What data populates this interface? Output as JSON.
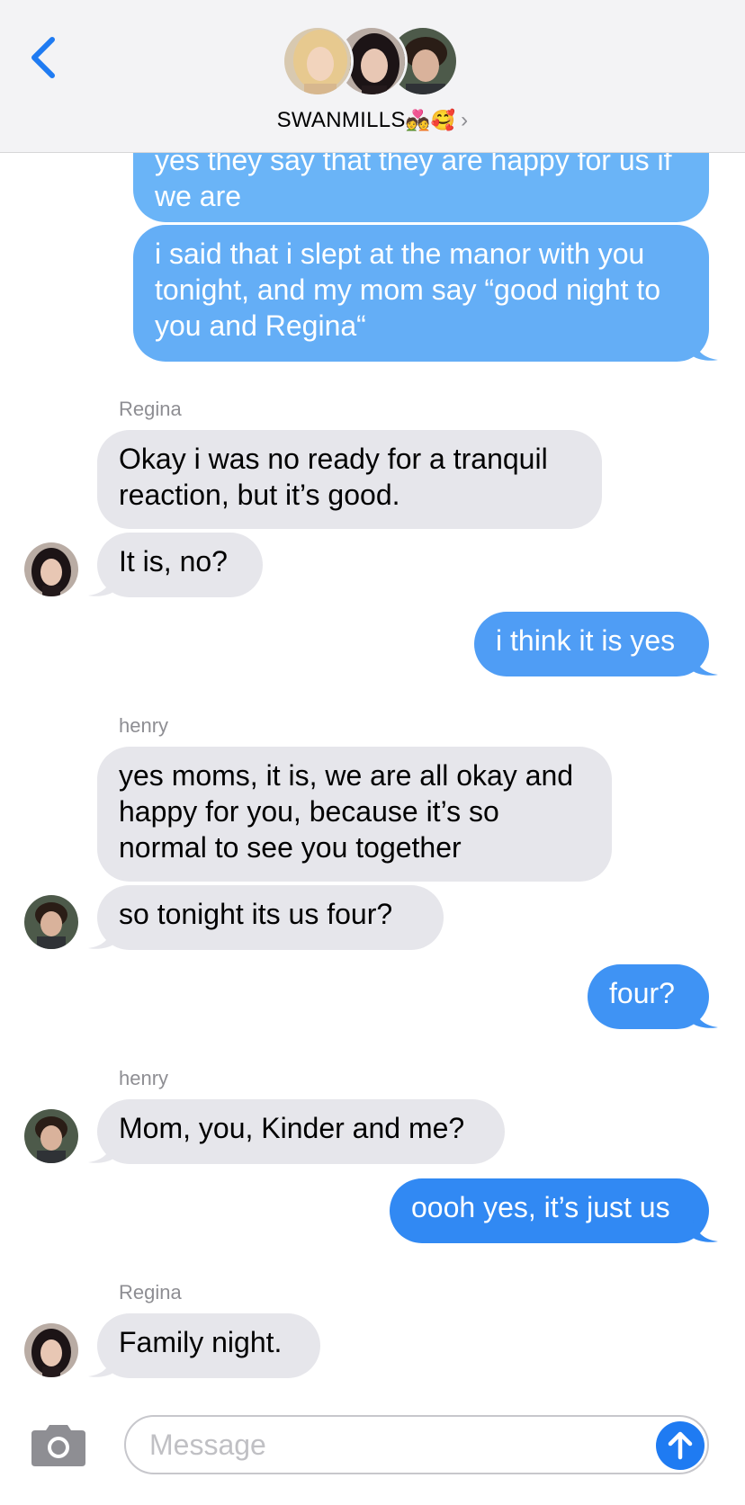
{
  "header": {
    "group_name": "SWANMILLS",
    "group_emoji": "💑🥰",
    "chevron": "›",
    "back_icon": "chevron-left-icon"
  },
  "messages": [
    {
      "direction": "outgoing",
      "text": "yes they say that they are happy for us if we are"
    },
    {
      "direction": "outgoing",
      "text": "i said that i slept at the manor with you tonight, and my mom say “good night to you and Regina“"
    },
    {
      "direction": "incoming",
      "sender": "Regina",
      "text": "Okay i was no ready for a tranquil reaction, but it’s good."
    },
    {
      "direction": "incoming",
      "sender": "Regina",
      "text": "It is, no?"
    },
    {
      "direction": "outgoing",
      "text": "i think it is yes"
    },
    {
      "direction": "incoming",
      "sender": "henry",
      "text": "yes moms, it is, we are all okay and happy for you, because it’s so normal to see you together"
    },
    {
      "direction": "incoming",
      "sender": "henry",
      "text": "so tonight its us four?"
    },
    {
      "direction": "outgoing",
      "text": "four?"
    },
    {
      "direction": "incoming",
      "sender": "henry",
      "text": "Mom, you, Kinder and me?"
    },
    {
      "direction": "outgoing",
      "text": "oooh yes, it’s just us"
    },
    {
      "direction": "incoming",
      "sender": "Regina",
      "text": "Family night."
    }
  ],
  "sender_labels": {
    "regina_1": "Regina",
    "henry_1": "henry",
    "henry_2": "henry",
    "regina_2": "Regina"
  },
  "composer": {
    "placeholder": "Message",
    "camera_icon": "camera-icon",
    "send_icon": "arrow-up-icon"
  },
  "colors": {
    "outgoing_bubble_top": "#6ab4f7",
    "outgoing_bubble_bottom": "#1f7bf2",
    "incoming_bubble": "#e6e6eb",
    "accent": "#1f7bf2",
    "sender_label": "#8e8e93"
  }
}
